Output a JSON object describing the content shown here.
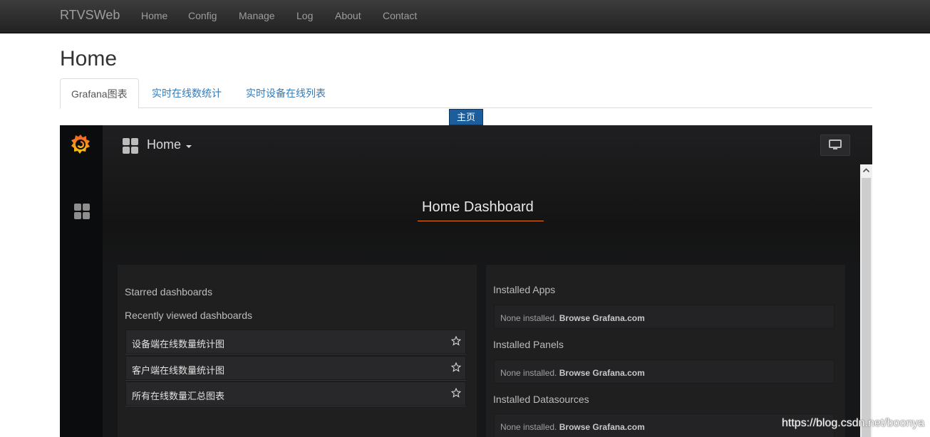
{
  "navbar": {
    "brand": "RTVSWeb",
    "links": [
      "Home",
      "Config",
      "Manage",
      "Log",
      "About",
      "Contact"
    ]
  },
  "page_title": "Home",
  "tabs": [
    "Grafana图表",
    "实时在线数统计",
    "实时设备在线列表"
  ],
  "home_button": "主页",
  "grafana": {
    "title": "Home",
    "dashboard_title": "Home Dashboard",
    "starred_label": "Starred dashboards",
    "recent_label": "Recently viewed dashboards",
    "recent_items": [
      "设备端在线数量统计图",
      "客户端在线数量统计图",
      "所有在线数量汇总图表"
    ],
    "installed_apps_label": "Installed Apps",
    "installed_panels_label": "Installed Panels",
    "installed_datasources_label": "Installed Datasources",
    "none_installed": "None installed.",
    "browse_link": "Browse Grafana.com",
    "accent": "#eb7b18"
  },
  "watermark": "https://blog.csdn.net/boonya"
}
